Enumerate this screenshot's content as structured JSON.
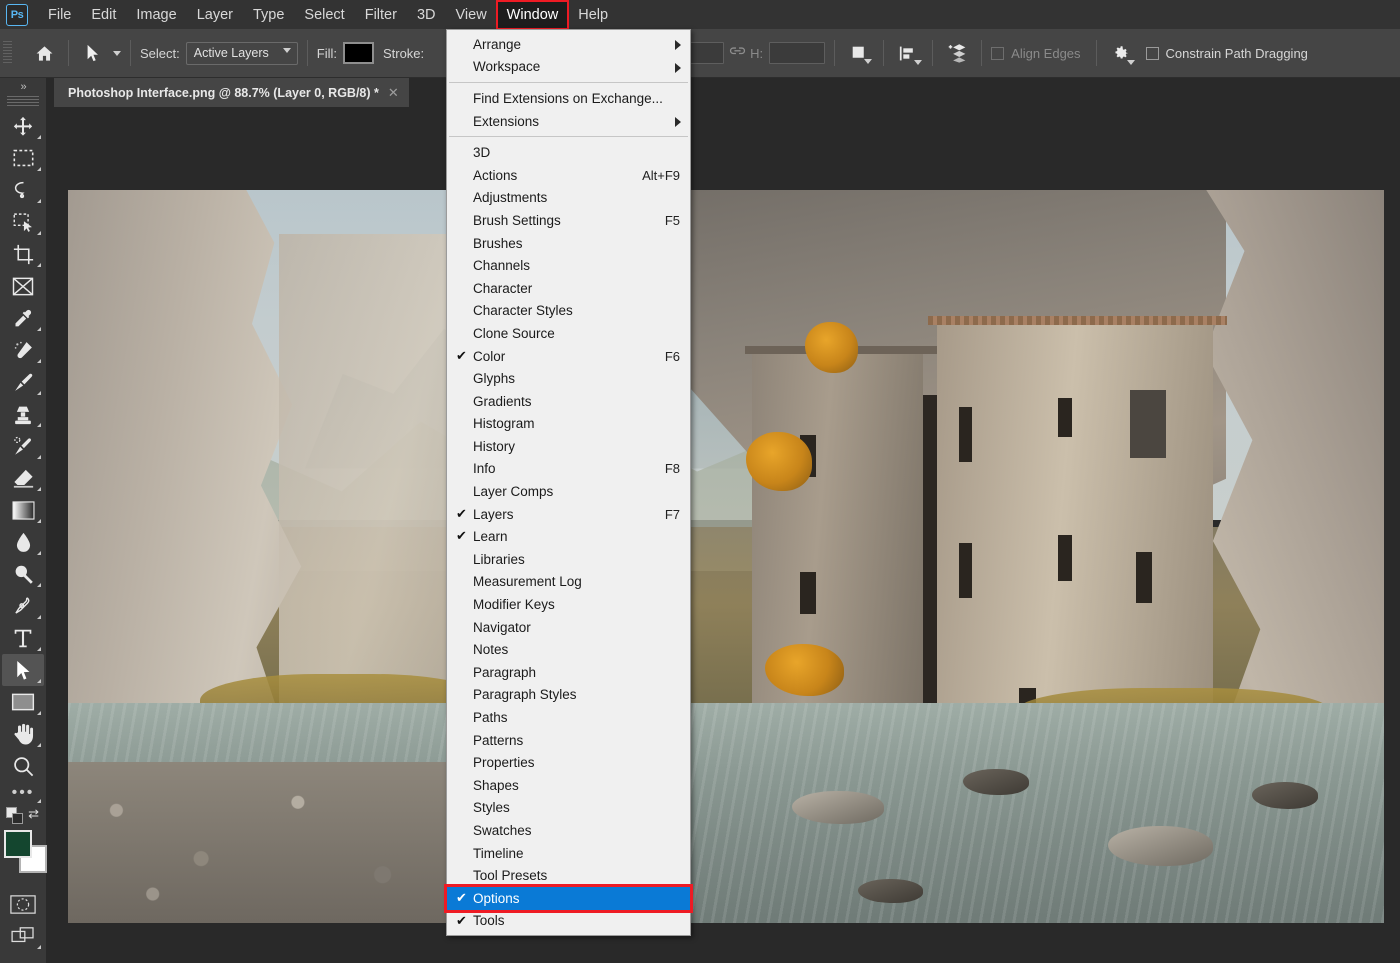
{
  "app": {
    "name": "Adobe Photoshop",
    "logo_text": "Ps"
  },
  "menubar": {
    "items": [
      {
        "label": "File",
        "active": false
      },
      {
        "label": "Edit",
        "active": false
      },
      {
        "label": "Image",
        "active": false
      },
      {
        "label": "Layer",
        "active": false
      },
      {
        "label": "Type",
        "active": false
      },
      {
        "label": "Select",
        "active": false
      },
      {
        "label": "Filter",
        "active": false
      },
      {
        "label": "3D",
        "active": false
      },
      {
        "label": "View",
        "active": false
      },
      {
        "label": "Window",
        "active": true
      },
      {
        "label": "Help",
        "active": false
      }
    ],
    "highlight_color": "#ee1b24"
  },
  "options_bar": {
    "home_icon": "home-icon",
    "tool_icon": "path-selection-icon",
    "select_label": "Select:",
    "select_value": "Active Layers",
    "fill_label": "Fill:",
    "fill_color": "#000000",
    "stroke_label": "Stroke:",
    "height_label": "H:",
    "link_icon": "link-icon",
    "align_edges_label": "Align Edges",
    "constrain_label": "Constrain Path Dragging",
    "gear_icon": "gear-icon",
    "path_ops_icon": "path-operations-icon",
    "path_align_icon": "path-alignment-icon",
    "path_arrange_icon": "path-arrangement-icon"
  },
  "document_tab": {
    "title": "Photoshop Interface.png @ 88.7% (Layer 0, RGB/8) *",
    "close_icon": "close-icon"
  },
  "toolbar": {
    "collapse_icon": "collapse-panel-icon",
    "tools": [
      {
        "name": "move-tool",
        "icon": "move-icon",
        "has_flyout": true,
        "selected": false
      },
      {
        "name": "rectangular-marquee-tool",
        "icon": "marquee-icon",
        "has_flyout": true,
        "selected": false
      },
      {
        "name": "lasso-tool",
        "icon": "lasso-icon",
        "has_flyout": true,
        "selected": false
      },
      {
        "name": "object-selection-tool",
        "icon": "object-selection-icon",
        "has_flyout": true,
        "selected": false
      },
      {
        "name": "crop-tool",
        "icon": "crop-icon",
        "has_flyout": true,
        "selected": false
      },
      {
        "name": "frame-tool",
        "icon": "frame-icon",
        "has_flyout": false,
        "selected": false
      },
      {
        "name": "eyedropper-tool",
        "icon": "eyedropper-icon",
        "has_flyout": true,
        "selected": false
      },
      {
        "name": "spot-healing-brush-tool",
        "icon": "healing-brush-icon",
        "has_flyout": true,
        "selected": false
      },
      {
        "name": "brush-tool",
        "icon": "brush-icon",
        "has_flyout": true,
        "selected": false
      },
      {
        "name": "clone-stamp-tool",
        "icon": "clone-stamp-icon",
        "has_flyout": true,
        "selected": false
      },
      {
        "name": "history-brush-tool",
        "icon": "history-brush-icon",
        "has_flyout": true,
        "selected": false
      },
      {
        "name": "eraser-tool",
        "icon": "eraser-icon",
        "has_flyout": true,
        "selected": false
      },
      {
        "name": "gradient-tool",
        "icon": "gradient-icon",
        "has_flyout": true,
        "selected": false
      },
      {
        "name": "blur-tool",
        "icon": "blur-drop-icon",
        "has_flyout": true,
        "selected": false
      },
      {
        "name": "dodge-tool",
        "icon": "dodge-icon",
        "has_flyout": true,
        "selected": false
      },
      {
        "name": "pen-tool",
        "icon": "pen-icon",
        "has_flyout": true,
        "selected": false
      },
      {
        "name": "type-tool",
        "icon": "type-t-icon",
        "has_flyout": true,
        "selected": false
      },
      {
        "name": "path-selection-tool",
        "icon": "path-selection-arrow-icon",
        "has_flyout": true,
        "selected": true
      },
      {
        "name": "rectangle-tool",
        "icon": "rectangle-icon",
        "has_flyout": true,
        "selected": false
      },
      {
        "name": "hand-tool",
        "icon": "hand-icon",
        "has_flyout": true,
        "selected": false
      },
      {
        "name": "zoom-tool",
        "icon": "magnifier-icon",
        "has_flyout": false,
        "selected": false
      }
    ],
    "more_tools_icon": "more-tools-icon",
    "default_colors_icon": "default-colors-icon",
    "swap_colors_icon": "swap-colors-icon",
    "foreground_color": "#14462f",
    "background_color": "#ffffff",
    "quick_mask_icon": "quick-mask-icon",
    "screen_mode_icon": "screen-mode-icon"
  },
  "window_menu": {
    "sections": [
      [
        {
          "label": "Arrange",
          "submenu": true,
          "checked": false,
          "accel": ""
        },
        {
          "label": "Workspace",
          "submenu": true,
          "checked": false,
          "accel": ""
        }
      ],
      [
        {
          "label": "Find Extensions on Exchange...",
          "submenu": false,
          "checked": false,
          "accel": ""
        },
        {
          "label": "Extensions",
          "submenu": true,
          "checked": false,
          "accel": ""
        }
      ],
      [
        {
          "label": "3D",
          "submenu": false,
          "checked": false,
          "accel": ""
        },
        {
          "label": "Actions",
          "submenu": false,
          "checked": false,
          "accel": "Alt+F9"
        },
        {
          "label": "Adjustments",
          "submenu": false,
          "checked": false,
          "accel": ""
        },
        {
          "label": "Brush Settings",
          "submenu": false,
          "checked": false,
          "accel": "F5"
        },
        {
          "label": "Brushes",
          "submenu": false,
          "checked": false,
          "accel": ""
        },
        {
          "label": "Channels",
          "submenu": false,
          "checked": false,
          "accel": ""
        },
        {
          "label": "Character",
          "submenu": false,
          "checked": false,
          "accel": ""
        },
        {
          "label": "Character Styles",
          "submenu": false,
          "checked": false,
          "accel": ""
        },
        {
          "label": "Clone Source",
          "submenu": false,
          "checked": false,
          "accel": ""
        },
        {
          "label": "Color",
          "submenu": false,
          "checked": true,
          "accel": "F6"
        },
        {
          "label": "Glyphs",
          "submenu": false,
          "checked": false,
          "accel": ""
        },
        {
          "label": "Gradients",
          "submenu": false,
          "checked": false,
          "accel": ""
        },
        {
          "label": "Histogram",
          "submenu": false,
          "checked": false,
          "accel": ""
        },
        {
          "label": "History",
          "submenu": false,
          "checked": false,
          "accel": ""
        },
        {
          "label": "Info",
          "submenu": false,
          "checked": false,
          "accel": "F8"
        },
        {
          "label": "Layer Comps",
          "submenu": false,
          "checked": false,
          "accel": ""
        },
        {
          "label": "Layers",
          "submenu": false,
          "checked": true,
          "accel": "F7"
        },
        {
          "label": "Learn",
          "submenu": false,
          "checked": true,
          "accel": ""
        },
        {
          "label": "Libraries",
          "submenu": false,
          "checked": false,
          "accel": ""
        },
        {
          "label": "Measurement Log",
          "submenu": false,
          "checked": false,
          "accel": ""
        },
        {
          "label": "Modifier Keys",
          "submenu": false,
          "checked": false,
          "accel": ""
        },
        {
          "label": "Navigator",
          "submenu": false,
          "checked": false,
          "accel": ""
        },
        {
          "label": "Notes",
          "submenu": false,
          "checked": false,
          "accel": ""
        },
        {
          "label": "Paragraph",
          "submenu": false,
          "checked": false,
          "accel": ""
        },
        {
          "label": "Paragraph Styles",
          "submenu": false,
          "checked": false,
          "accel": ""
        },
        {
          "label": "Paths",
          "submenu": false,
          "checked": false,
          "accel": ""
        },
        {
          "label": "Patterns",
          "submenu": false,
          "checked": false,
          "accel": ""
        },
        {
          "label": "Properties",
          "submenu": false,
          "checked": false,
          "accel": ""
        },
        {
          "label": "Shapes",
          "submenu": false,
          "checked": false,
          "accel": ""
        },
        {
          "label": "Styles",
          "submenu": false,
          "checked": false,
          "accel": ""
        },
        {
          "label": "Swatches",
          "submenu": false,
          "checked": false,
          "accel": ""
        },
        {
          "label": "Timeline",
          "submenu": false,
          "checked": false,
          "accel": ""
        },
        {
          "label": "Tool Presets",
          "submenu": false,
          "checked": false,
          "accel": ""
        },
        {
          "label": "Options",
          "submenu": false,
          "checked": true,
          "accel": "",
          "highlighted": true,
          "annotated": true
        },
        {
          "label": "Tools",
          "submenu": false,
          "checked": true,
          "accel": ""
        }
      ]
    ],
    "highlight_bg": "#0a7ad6",
    "annotation_color": "#ee1b24"
  },
  "canvas": {
    "description": "Mountain valley landscape with ruined stone building on a cliff and a rocky river"
  }
}
